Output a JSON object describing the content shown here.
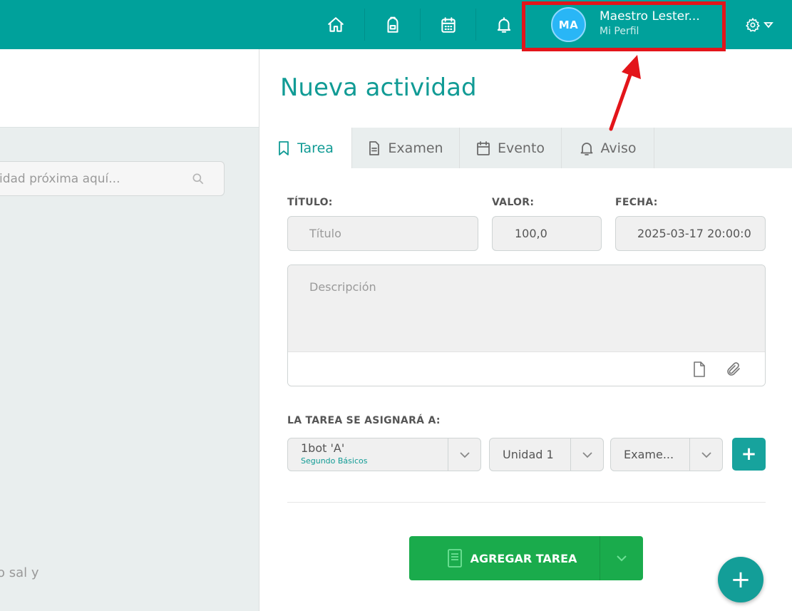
{
  "topbar": {
    "nav_icons": [
      "home-icon",
      "backpack-icon",
      "calendar-icon",
      "bell-icon"
    ],
    "profile": {
      "initials": "MA",
      "name": "Maestro Lester...",
      "subtitle": "Mi Perfil"
    },
    "settings_icon": "gear-icon"
  },
  "left_panel": {
    "search_placeholder": "idad próxima aquí...",
    "bottom_text": "o sal y"
  },
  "main": {
    "title": "Nueva actividad",
    "tabs": [
      {
        "label": "Tarea",
        "icon": "bookmark-icon",
        "active": true
      },
      {
        "label": "Examen",
        "icon": "document-icon",
        "active": false
      },
      {
        "label": "Evento",
        "icon": "calendar-icon",
        "active": false
      },
      {
        "label": "Aviso",
        "icon": "bell-icon",
        "active": false
      }
    ],
    "form": {
      "titulo_label": "TÍTULO:",
      "titulo_placeholder": "Título",
      "valor_label": "VALOR:",
      "valor_value": "100,0",
      "fecha_label": "FECHA:",
      "fecha_value": "2025-03-17 20:00:0",
      "descripcion_placeholder": "Descripción",
      "assign_label": "LA TAREA SE ASIGNARÁ A:",
      "select_group": {
        "value": "1bot 'A'",
        "sub": "Segundo Básicos"
      },
      "select_unit": {
        "value": "Unidad 1"
      },
      "select_type": {
        "value": "Exame..."
      },
      "add_small": "+"
    },
    "submit_label": "AGREGAR TAREA",
    "fab_label": "+"
  },
  "colors": {
    "brand": "#00a19b",
    "accent_text": "#119b95",
    "submit": "#1aab4c",
    "highlight": "#e3151a"
  }
}
